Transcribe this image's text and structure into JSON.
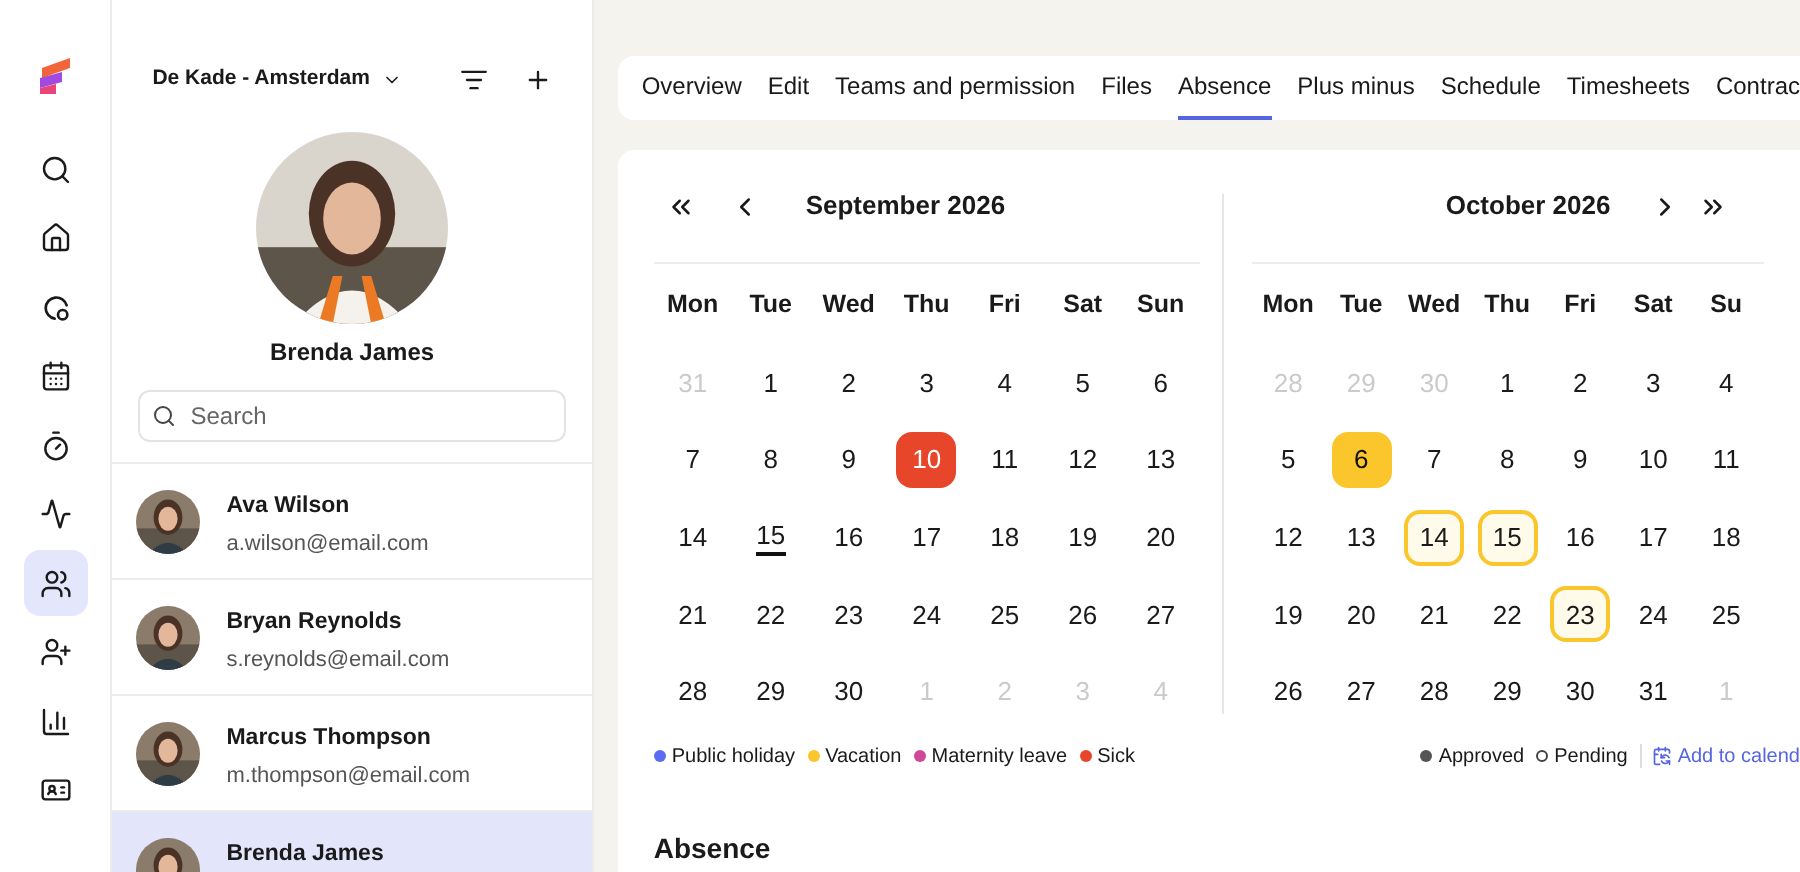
{
  "nav": [
    {
      "selected": false
    },
    {
      "selected": false
    },
    {
      "selected": false
    },
    {
      "selected": false
    },
    {
      "selected": false
    },
    {
      "selected": false
    },
    {
      "selected": true
    },
    {
      "selected": false
    },
    {
      "selected": false
    },
    {
      "selected": false
    }
  ],
  "location": {
    "label": "De Kade - Amsterdam"
  },
  "profile": {
    "name": "Brenda James"
  },
  "search": {
    "placeholder": "Search"
  },
  "contacts": [
    {
      "name": "Ava Wilson",
      "email": "a.wilson@email.com",
      "selected": false
    },
    {
      "name": "Bryan Reynolds",
      "email": "s.reynolds@email.com",
      "selected": false
    },
    {
      "name": "Marcus Thompson",
      "email": "m.thompson@email.com",
      "selected": false
    },
    {
      "name": "Brenda James",
      "selected": true
    }
  ],
  "tabs": [
    {
      "label": "Overview",
      "selected": false
    },
    {
      "label": "Edit",
      "selected": false
    },
    {
      "label": "Teams and permission",
      "selected": false
    },
    {
      "label": "Files",
      "selected": false
    },
    {
      "label": "Absence",
      "selected": true
    },
    {
      "label": "Plus minus",
      "selected": false
    },
    {
      "label": "Schedule",
      "selected": false
    },
    {
      "label": "Timesheets",
      "selected": false
    },
    {
      "label": "Contrac",
      "selected": false
    }
  ],
  "calendars": [
    {
      "title": "September 2026",
      "weekdays": [
        "Mon",
        "Tue",
        "Wed",
        "Thu",
        "Fri",
        "Sat",
        "Sun"
      ],
      "days": [
        {
          "label": "31",
          "outside": true,
          "today": false
        },
        {
          "label": "1",
          "outside": false,
          "today": false
        },
        {
          "label": "2",
          "outside": false,
          "today": false
        },
        {
          "label": "3",
          "outside": false,
          "today": false
        },
        {
          "label": "4",
          "outside": false,
          "today": false
        },
        {
          "label": "5",
          "outside": false,
          "today": false
        },
        {
          "label": "6",
          "outside": false,
          "today": false
        },
        {
          "label": "7",
          "outside": false,
          "today": false
        },
        {
          "label": "8",
          "outside": false,
          "today": false
        },
        {
          "label": "9",
          "outside": false,
          "today": false
        },
        {
          "label": "10",
          "outside": false,
          "today": false,
          "absence": {
            "kind": "approved",
            "color": "#e8462a"
          }
        },
        {
          "label": "11",
          "outside": false,
          "today": false
        },
        {
          "label": "12",
          "outside": false,
          "today": false
        },
        {
          "label": "13",
          "outside": false,
          "today": false
        },
        {
          "label": "14",
          "outside": false,
          "today": false
        },
        {
          "label": "15",
          "outside": false,
          "today": true
        },
        {
          "label": "16",
          "outside": false,
          "today": false
        },
        {
          "label": "17",
          "outside": false,
          "today": false
        },
        {
          "label": "18",
          "outside": false,
          "today": false
        },
        {
          "label": "19",
          "outside": false,
          "today": false
        },
        {
          "label": "20",
          "outside": false,
          "today": false
        },
        {
          "label": "21",
          "outside": false,
          "today": false
        },
        {
          "label": "22",
          "outside": false,
          "today": false
        },
        {
          "label": "23",
          "outside": false,
          "today": false
        },
        {
          "label": "24",
          "outside": false,
          "today": false
        },
        {
          "label": "25",
          "outside": false,
          "today": false
        },
        {
          "label": "26",
          "outside": false,
          "today": false
        },
        {
          "label": "27",
          "outside": false,
          "today": false
        },
        {
          "label": "28",
          "outside": false,
          "today": false
        },
        {
          "label": "29",
          "outside": false,
          "today": false
        },
        {
          "label": "30",
          "outside": false,
          "today": false
        },
        {
          "label": "1",
          "outside": true,
          "today": false
        },
        {
          "label": "2",
          "outside": true,
          "today": false
        },
        {
          "label": "3",
          "outside": true,
          "today": false
        },
        {
          "label": "4",
          "outside": true,
          "today": false
        }
      ]
    },
    {
      "title": "October 2026",
      "weekdays": [
        "Mon",
        "Tue",
        "Wed",
        "Thu",
        "Fri",
        "Sat",
        "Su"
      ],
      "days": [
        {
          "label": "28",
          "outside": true,
          "today": false
        },
        {
          "label": "29",
          "outside": true,
          "today": false
        },
        {
          "label": "30",
          "outside": true,
          "today": false
        },
        {
          "label": "1",
          "outside": false,
          "today": false
        },
        {
          "label": "2",
          "outside": false,
          "today": false
        },
        {
          "label": "3",
          "outside": false,
          "today": false
        },
        {
          "label": "4",
          "outside": false,
          "today": false
        },
        {
          "label": "5",
          "outside": false,
          "today": false
        },
        {
          "label": "6",
          "outside": false,
          "today": false,
          "absence": {
            "kind": "approved",
            "color": "#fbc52c"
          }
        },
        {
          "label": "7",
          "outside": false,
          "today": false
        },
        {
          "label": "8",
          "outside": false,
          "today": false
        },
        {
          "label": "9",
          "outside": false,
          "today": false
        },
        {
          "label": "10",
          "outside": false,
          "today": false
        },
        {
          "label": "11",
          "outside": false,
          "today": false
        },
        {
          "label": "12",
          "outside": false,
          "today": false
        },
        {
          "label": "13",
          "outside": false,
          "today": false
        },
        {
          "label": "14",
          "outside": false,
          "today": false,
          "absence": {
            "kind": "pending",
            "color": "#fbc52c"
          }
        },
        {
          "label": "15",
          "outside": false,
          "today": false,
          "absence": {
            "kind": "pending",
            "color": "#fbc52c"
          }
        },
        {
          "label": "16",
          "outside": false,
          "today": false
        },
        {
          "label": "17",
          "outside": false,
          "today": false
        },
        {
          "label": "18",
          "outside": false,
          "today": false
        },
        {
          "label": "19",
          "outside": false,
          "today": false
        },
        {
          "label": "20",
          "outside": false,
          "today": false
        },
        {
          "label": "21",
          "outside": false,
          "today": false
        },
        {
          "label": "22",
          "outside": false,
          "today": false
        },
        {
          "label": "23",
          "outside": false,
          "today": false,
          "absence": {
            "kind": "pending",
            "color": "#fbc52c"
          }
        },
        {
          "label": "24",
          "outside": false,
          "today": false
        },
        {
          "label": "25",
          "outside": false,
          "today": false
        },
        {
          "label": "26",
          "outside": false,
          "today": false
        },
        {
          "label": "27",
          "outside": false,
          "today": false
        },
        {
          "label": "28",
          "outside": false,
          "today": false
        },
        {
          "label": "29",
          "outside": false,
          "today": false
        },
        {
          "label": "30",
          "outside": false,
          "today": false
        },
        {
          "label": "31",
          "outside": false,
          "today": false
        },
        {
          "label": "1",
          "outside": true,
          "today": false
        }
      ]
    }
  ],
  "legend": [
    {
      "label": "Public holiday",
      "color": "#5b6cf0"
    },
    {
      "label": "Vacation",
      "color": "#fbc52c"
    },
    {
      "label": "Maternity leave",
      "color": "#d0489a"
    },
    {
      "label": "Sick",
      "color": "#e8462a"
    }
  ],
  "status_legend": [
    {
      "label": "Approved",
      "kind": "filled"
    },
    {
      "label": "Pending",
      "kind": "hollow"
    }
  ],
  "add_link": {
    "label": "Add to calend"
  },
  "section": {
    "title": "Absence"
  }
}
